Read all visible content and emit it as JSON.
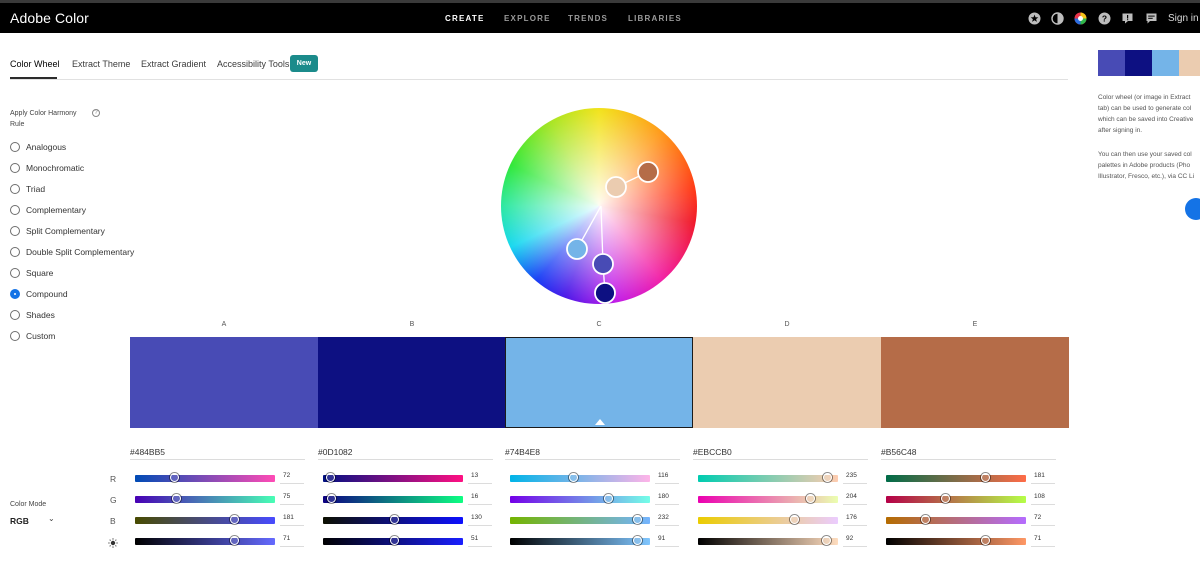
{
  "app": {
    "title": "Adobe Color"
  },
  "nav": {
    "items": [
      {
        "label": "CREATE",
        "active": true
      },
      {
        "label": "EXPLORE",
        "active": false
      },
      {
        "label": "TRENDS",
        "active": false
      },
      {
        "label": "LIBRARIES",
        "active": false
      }
    ],
    "icons": [
      "star-icon",
      "contrast-icon",
      "color-wheel-icon",
      "help-icon",
      "feedback-icon",
      "chat-icon"
    ],
    "signin_label": "Sign in"
  },
  "tabs": [
    {
      "label": "Color Wheel",
      "active": true
    },
    {
      "label": "Extract Theme",
      "active": false
    },
    {
      "label": "Extract Gradient",
      "active": false
    },
    {
      "label": "Accessibility Tools",
      "active": false
    }
  ],
  "new_badge": "New",
  "harmony": {
    "title": "Apply Color Harmony Rule",
    "help_glyph": "?",
    "rules": [
      {
        "label": "Analogous",
        "checked": false
      },
      {
        "label": "Monochromatic",
        "checked": false
      },
      {
        "label": "Triad",
        "checked": false
      },
      {
        "label": "Complementary",
        "checked": false
      },
      {
        "label": "Split Complementary",
        "checked": false
      },
      {
        "label": "Double Split Complementary",
        "checked": false
      },
      {
        "label": "Square",
        "checked": false
      },
      {
        "label": "Compound",
        "checked": true
      },
      {
        "label": "Shades",
        "checked": false
      },
      {
        "label": "Custom",
        "checked": false
      }
    ]
  },
  "color_mode": {
    "label": "Color Mode",
    "value": "RGB",
    "chevron": "⌄"
  },
  "channels": [
    "R",
    "G",
    "B"
  ],
  "swatches": [
    {
      "letter": "A",
      "hex": "#484BB5",
      "color": "#484BB5",
      "selected": false,
      "r": 72,
      "g": 75,
      "b": 181,
      "brightness": 71
    },
    {
      "letter": "B",
      "hex": "#0D1082",
      "color": "#0D1082",
      "selected": false,
      "r": 13,
      "g": 16,
      "b": 130,
      "brightness": 51
    },
    {
      "letter": "C",
      "hex": "#74B4E8",
      "color": "#74B4E8",
      "selected": true,
      "r": 116,
      "g": 180,
      "b": 232,
      "brightness": 91
    },
    {
      "letter": "D",
      "hex": "#EBCCB0",
      "color": "#EBCCB0",
      "selected": false,
      "r": 235,
      "g": 204,
      "b": 176,
      "brightness": 92
    },
    {
      "letter": "E",
      "hex": "#B56C48",
      "color": "#B56C48",
      "selected": false,
      "r": 181,
      "g": 108,
      "b": 72,
      "brightness": 71
    }
  ],
  "sidebar": {
    "mini_theme": [
      "#484BB5",
      "#0D1082",
      "#74B4E8",
      "#EBCCB0"
    ],
    "info_lines_1": [
      "Color wheel (or image in Extract",
      "tab) can be used to generate col",
      "which can be saved into Creative",
      "after signing in."
    ],
    "info_lines_2": [
      "You can then use your saved col",
      "palettes in Adobe products (Pho",
      "Illustrator, Fresco, etc.), via CC Li"
    ]
  }
}
